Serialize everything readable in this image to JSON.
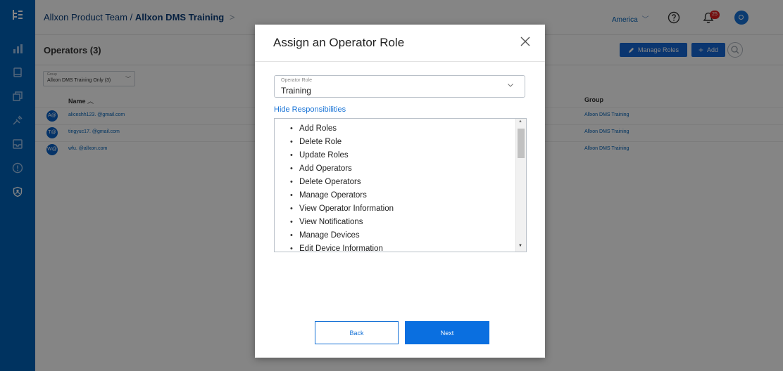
{
  "header": {
    "team": "Allxon Product Team /",
    "project": "Allxon DMS Training",
    "project_chevron": ">",
    "region": "America",
    "region_chevron": "﹀",
    "notification_count": "25"
  },
  "sidebar": {
    "items": [
      {
        "icon": "app-logo-icon"
      },
      {
        "icon": "bar-chart-icon"
      },
      {
        "icon": "device-icon"
      },
      {
        "icon": "device-group-icon"
      },
      {
        "icon": "plugin-icon"
      },
      {
        "icon": "inbox-icon"
      },
      {
        "icon": "alert-icon"
      },
      {
        "icon": "operator-role-icon"
      }
    ]
  },
  "page": {
    "title": "Operators (3)",
    "manage_roles_label": "Manage Roles",
    "add_label": "Add"
  },
  "group_filter": {
    "label": "Group",
    "value": "Allxon DMS Training Only (3)",
    "chevron": "﹀"
  },
  "table": {
    "columns": {
      "name": "Name",
      "name_sort": "︿",
      "group": "Group"
    },
    "rows": [
      {
        "initials": "A@",
        "email": "aliceshh123. @gmail.com",
        "group": "Allxon DMS Training"
      },
      {
        "initials": "T@",
        "email": "tingyuc17. @gmail.com",
        "group": "Allxon DMS Training"
      },
      {
        "initials": "W@",
        "email": "wfu. @allxon.com",
        "group": "Allxon DMS Training"
      }
    ]
  },
  "modal": {
    "title": "Assign an Operator Role",
    "role_label": "Operator Role",
    "role_value": "Training",
    "hide_link": "Hide Responsibilities",
    "responsibilities": [
      "Add Roles",
      "Delete Role",
      "Update Roles",
      "Add Operators",
      "Delete Operators",
      "Manage Operators",
      "View Operator Information",
      "View Notifications",
      "Manage Devices",
      "Edit Device Information"
    ],
    "back_label": "Back",
    "next_label": "Next"
  },
  "colors": {
    "sidebar": "#0062b8",
    "primary": "#0a6fe0",
    "link": "#1672d6",
    "badge": "#e02020"
  }
}
